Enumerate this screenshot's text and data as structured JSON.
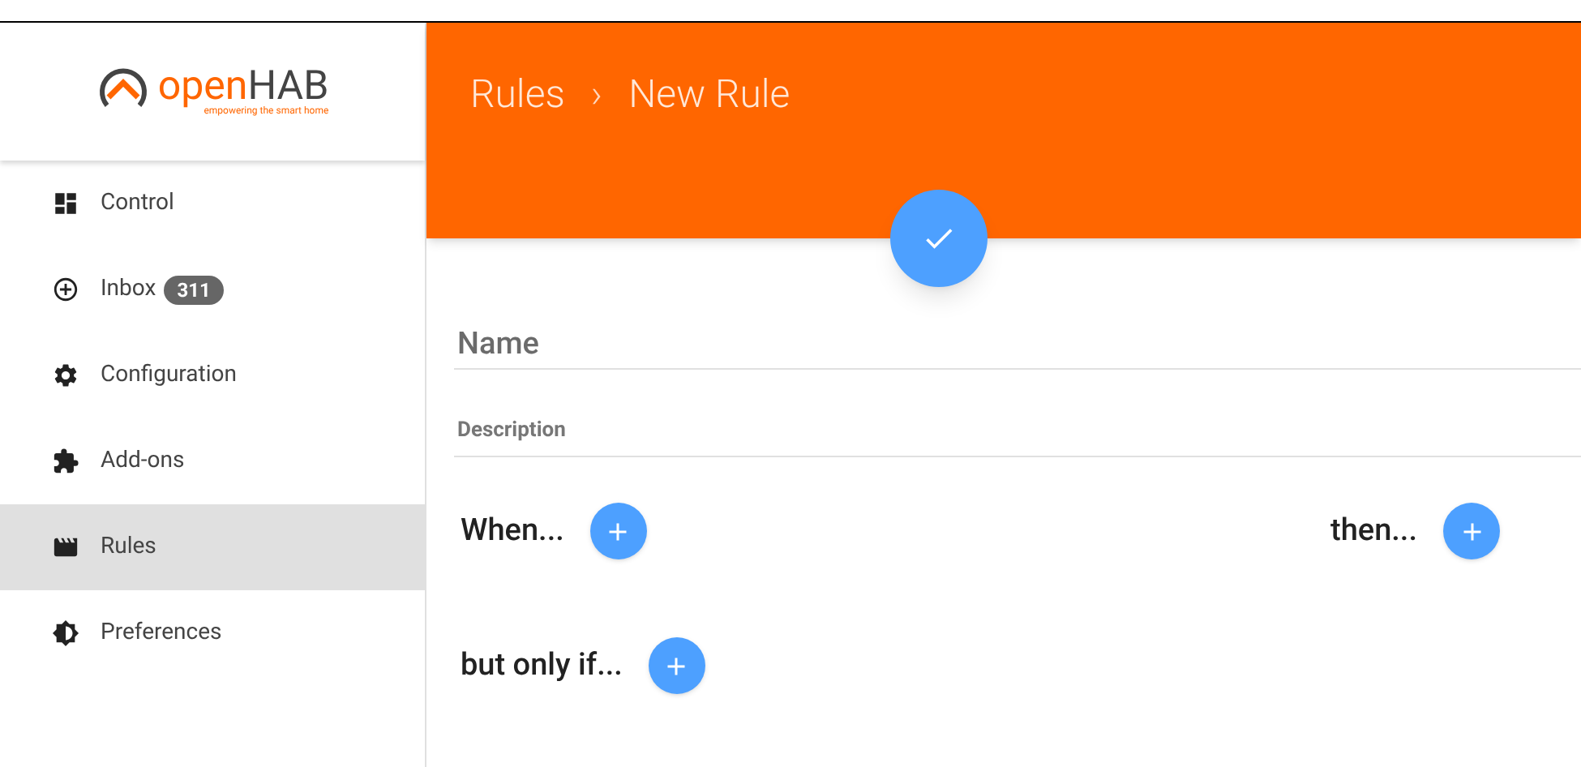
{
  "logo": {
    "brand_a": "open",
    "brand_b": "HAB",
    "tagline": "empowering the smart home"
  },
  "sidebar": {
    "items": [
      {
        "label": "Control",
        "kind": "control",
        "selected": false
      },
      {
        "label": "Inbox",
        "kind": "inbox",
        "badge": "311",
        "selected": false
      },
      {
        "label": "Configuration",
        "kind": "configuration",
        "selected": false
      },
      {
        "label": "Add-ons",
        "kind": "addons",
        "selected": false
      },
      {
        "label": "Rules",
        "kind": "rules",
        "selected": true
      },
      {
        "label": "Preferences",
        "kind": "preferences",
        "selected": false
      }
    ]
  },
  "header": {
    "breadcrumb": [
      "Rules",
      "New Rule"
    ],
    "separator": "›"
  },
  "form": {
    "name": {
      "placeholder": "Name"
    },
    "description": {
      "placeholder": "Description"
    }
  },
  "sections": {
    "when": "When...",
    "then": "then...",
    "only_if": "but only if..."
  }
}
